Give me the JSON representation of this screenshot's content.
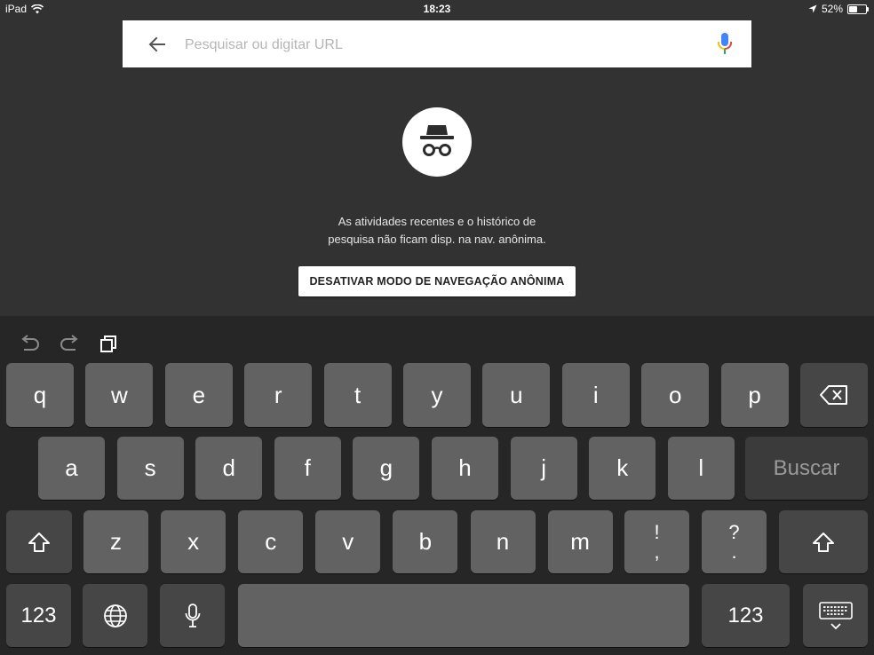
{
  "status_bar": {
    "device": "iPad",
    "time": "18:23",
    "battery": "52%",
    "battery_level": 0.52
  },
  "omnibox": {
    "placeholder": "Pesquisar ou digitar URL",
    "value": ""
  },
  "incognito": {
    "line1": "As atividades recentes e o histórico de",
    "line2": "pesquisa não ficam disp. na nav. anônima.",
    "button_label": "DESATIVAR MODO DE NAVEGAÇÃO ANÔNIMA"
  },
  "keyboard": {
    "row1": [
      "q",
      "w",
      "e",
      "r",
      "t",
      "y",
      "u",
      "i",
      "o",
      "p"
    ],
    "row2": [
      "a",
      "s",
      "d",
      "f",
      "g",
      "h",
      "j",
      "k",
      "l"
    ],
    "row3": [
      "z",
      "x",
      "c",
      "v",
      "b",
      "n",
      "m"
    ],
    "exclaim_top": "!",
    "exclaim_bottom": ",",
    "question_top": "?",
    "question_bottom": ".",
    "search_label": "Buscar",
    "numbers_label": "123"
  },
  "colors": {
    "background": "#323232",
    "keyboard": "#262626",
    "key": "#626262",
    "key_dark": "#464646",
    "mic_blue": "#4285F4",
    "mic_red": "#EA4335",
    "mic_yellow": "#FBBC05",
    "mic_green": "#34A853"
  }
}
